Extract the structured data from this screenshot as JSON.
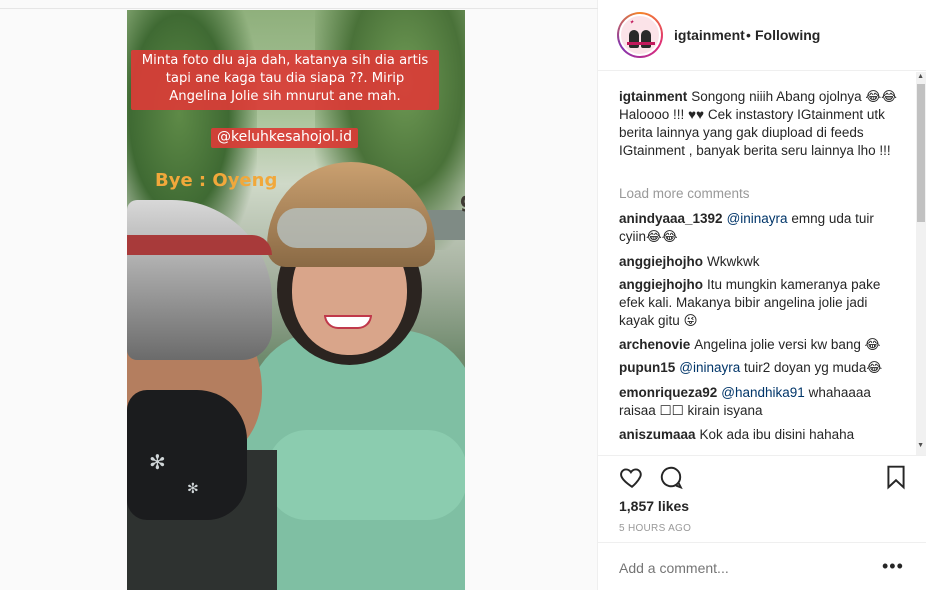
{
  "photo": {
    "caption_text": "Minta foto dlu aja dah, katanya sih dia artis tapi ane kaga tau dia siapa ??. Mirip Angelina Jolie sih mnurut ane mah.",
    "handle_text": "@keluhkesahojol.id",
    "bye_text": "Bye : Oyeng",
    "helmet_logo": "grab"
  },
  "header": {
    "username": "igtainment",
    "separator": "•",
    "follow_status": "Following"
  },
  "caption": {
    "username": "igtainment",
    "text": "Songong niiih Abang ojolnya 😂😂 Haloooo !!! ♥♥ Cek instastory IGtainment utk berita lainnya yang gak diupload di feeds IGtainment , banyak berita seru lainnya lho !!!"
  },
  "load_more": "Load more comments",
  "comments": [
    {
      "user": "anindyaaa_1392",
      "mention": "@ininayra",
      "text": "emng uda tuir cyiin😂😂"
    },
    {
      "user": "anggiejhojho",
      "mention": "",
      "text": "Wkwkwk"
    },
    {
      "user": "anggiejhojho",
      "mention": "",
      "text": "Itu mungkin kameranya pake efek kali. Makanya bibir angelina jolie jadi kayak gitu 😜"
    },
    {
      "user": "archenovie",
      "mention": "",
      "text": "Angelina jolie versi kw bang 😂"
    },
    {
      "user": "pupun15",
      "mention": "@ininayra",
      "text": "tuir2 doyan yg muda😂"
    },
    {
      "user": "emonriqueza92",
      "mention": "@handhika91",
      "text": "whahaaaa raisaa ☐☐ kirain isyana"
    },
    {
      "user": "aniszumaaa",
      "mention": "",
      "text": "Kok ada ibu disini hahaha"
    }
  ],
  "actions": {
    "likes": "1,857 likes",
    "time": "5 HOURS AGO",
    "add_comment_placeholder": "Add a comment...",
    "more_label": "•••"
  },
  "icons": [
    "heart-icon",
    "comment-icon",
    "bookmark-icon",
    "more-options-icon"
  ]
}
